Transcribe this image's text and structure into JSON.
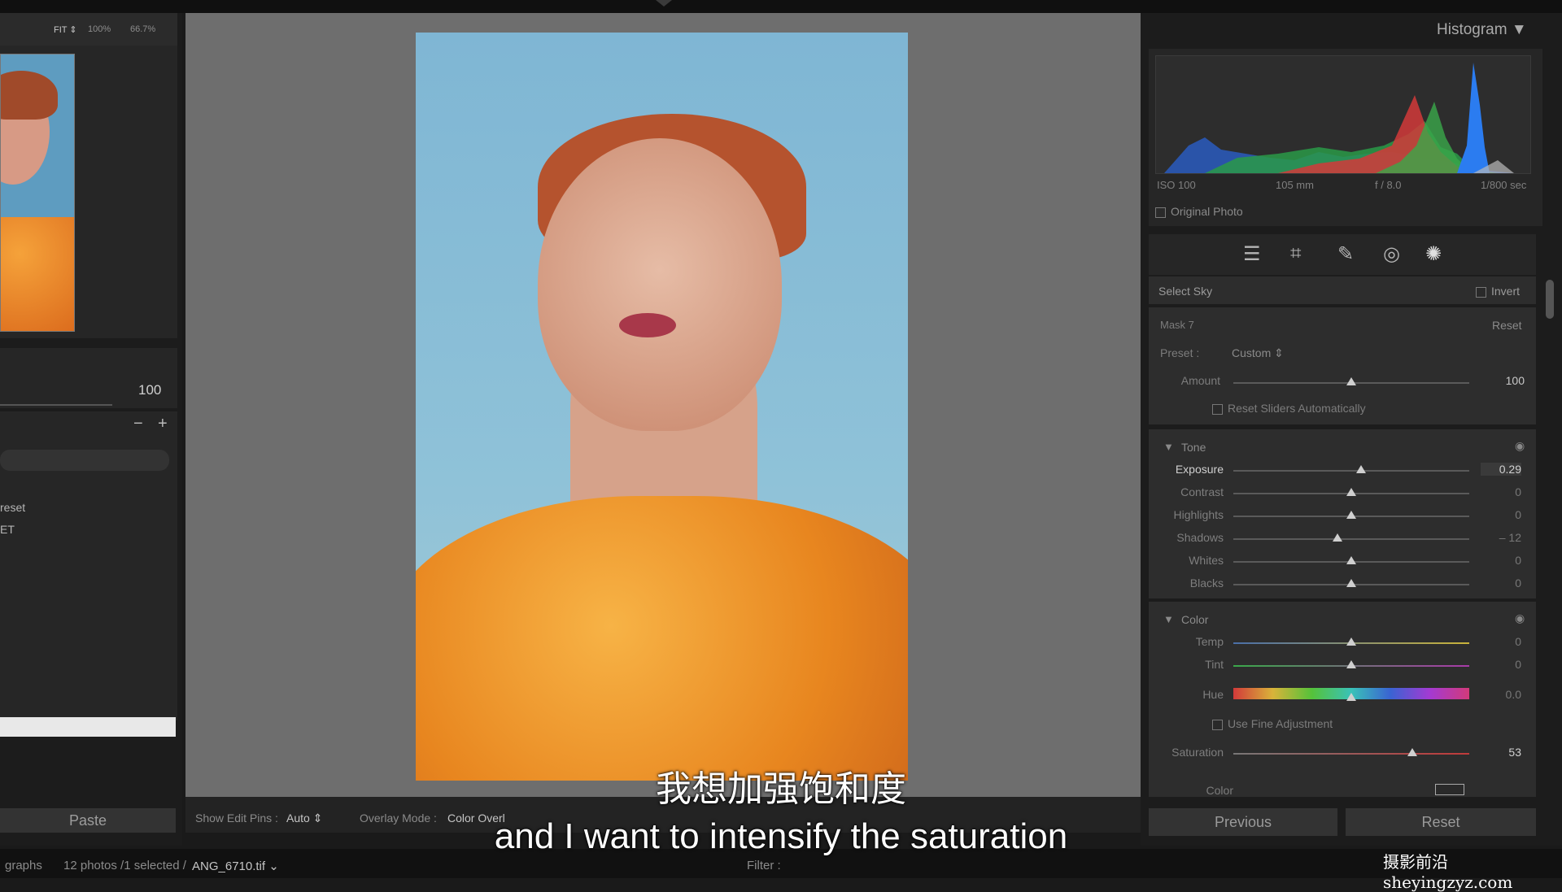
{
  "navigator": {
    "fit": "FIT ⇕",
    "z100": "100%",
    "z66": "66.7%",
    "amount_value": "100",
    "minus": "−",
    "plus": "+",
    "preset_item1": "reset",
    "preset_item2": "ET",
    "paste": "Paste"
  },
  "center_toolbar": {
    "show_edit_pins_label": "Show Edit Pins :",
    "show_edit_pins_value": "Auto ⇕",
    "overlay_mode_label": "Overlay Mode :",
    "overlay_mode_value": "Color Overl"
  },
  "histogram": {
    "title": "Histogram ▼",
    "iso": "ISO 100",
    "focal": "105 mm",
    "aperture": "f / 8.0",
    "shutter": "1/800 sec",
    "original_photo": "Original Photo"
  },
  "mask": {
    "select_sky": "Select Sky",
    "invert": "Invert",
    "mask_name": "Mask 7",
    "reset": "Reset",
    "preset_label": "Preset :",
    "preset_value": "Custom ⇕",
    "amount_label": "Amount",
    "amount_value": "100",
    "amount_pos": 0.5,
    "reset_sliders": "Reset Sliders Automatically"
  },
  "tone": {
    "title": "Tone",
    "sliders": [
      {
        "label": "Exposure",
        "value": "0.29",
        "pos": 0.54
      },
      {
        "label": "Contrast",
        "value": "0",
        "pos": 0.5
      },
      {
        "label": "Highlights",
        "value": "0",
        "pos": 0.5
      },
      {
        "label": "Shadows",
        "value": "– 12",
        "pos": 0.44
      },
      {
        "label": "Whites",
        "value": "0",
        "pos": 0.5
      },
      {
        "label": "Blacks",
        "value": "0",
        "pos": 0.5
      }
    ]
  },
  "color": {
    "title": "Color",
    "temp": {
      "label": "Temp",
      "value": "0",
      "pos": 0.5
    },
    "tint": {
      "label": "Tint",
      "value": "0",
      "pos": 0.5
    },
    "hue": {
      "label": "Hue",
      "value": "0.0",
      "pos": 0.5
    },
    "fine_adjustment": "Use Fine Adjustment",
    "saturation": {
      "label": "Saturation",
      "value": "53",
      "pos": 0.76
    },
    "color_label": "Color"
  },
  "buttons": {
    "previous": "Previous",
    "reset": "Reset"
  },
  "filmstrip": {
    "source": "graphs",
    "count": "12 photos /1 selected /",
    "filename": "ANG_6710.tif ⌄",
    "filter": "Filter :"
  },
  "subtitles": {
    "zh": "我想加强饱和度",
    "en": "and I want to intensify the saturation"
  },
  "watermark": "摄影前沿 sheyingzyz.com"
}
